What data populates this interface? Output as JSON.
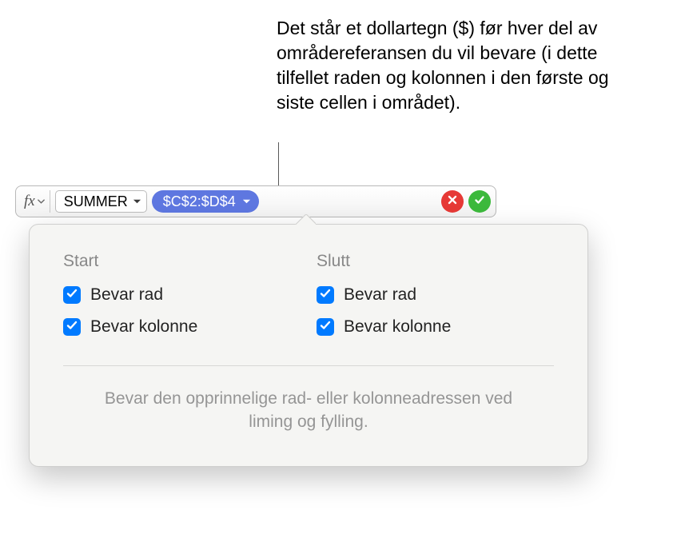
{
  "annotation": "Det står et dollartegn ($) før hver del av områdereferansen du vil bevare (i dette tilfellet raden og kolonnen i den første og siste cellen i området).",
  "formula_bar": {
    "fx_label": "fx",
    "function_name": "SUMMER",
    "range_reference": "$C$2:$D$4"
  },
  "popover": {
    "start": {
      "heading": "Start",
      "preserve_row": "Bevar rad",
      "preserve_column": "Bevar kolonne"
    },
    "end": {
      "heading": "Slutt",
      "preserve_row": "Bevar rad",
      "preserve_column": "Bevar kolonne"
    },
    "footer": "Bevar den opprinnelige rad- eller kolonneadressen ved liming og fylling."
  },
  "checkbox_states": {
    "start_row": true,
    "start_column": true,
    "end_row": true,
    "end_column": true
  },
  "colors": {
    "range_pill": "#5e77e0",
    "checkbox": "#007aff",
    "cancel": "#e63936",
    "accept": "#3cb93c"
  }
}
